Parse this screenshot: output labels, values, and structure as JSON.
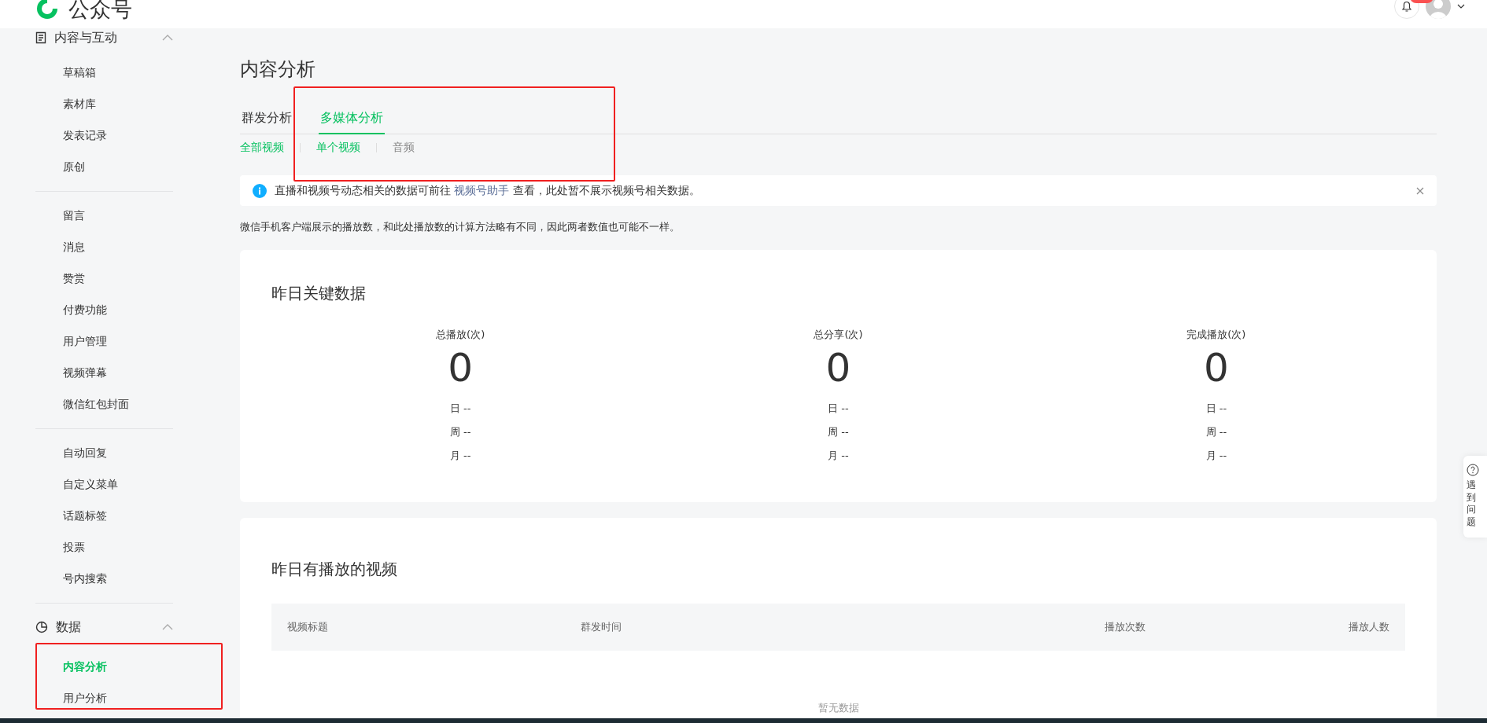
{
  "header": {
    "logo_text": "公众号"
  },
  "sidebar": {
    "groups": [
      {
        "title": "内容与互动",
        "expanded": true,
        "sections": [
          [
            {
              "label": "草稿箱",
              "selected": false
            },
            {
              "label": "素材库",
              "selected": false
            },
            {
              "label": "发表记录",
              "selected": false
            },
            {
              "label": "原创",
              "selected": false
            }
          ],
          [
            {
              "label": "留言",
              "selected": false
            },
            {
              "label": "消息",
              "selected": false
            },
            {
              "label": "赞赏",
              "selected": false
            },
            {
              "label": "付费功能",
              "selected": false
            },
            {
              "label": "用户管理",
              "selected": false
            },
            {
              "label": "视频弹幕",
              "selected": false
            },
            {
              "label": "微信红包封面",
              "selected": false
            }
          ],
          [
            {
              "label": "自动回复",
              "selected": false
            },
            {
              "label": "自定义菜单",
              "selected": false
            },
            {
              "label": "话题标签",
              "selected": false
            },
            {
              "label": "投票",
              "selected": false
            },
            {
              "label": "号内搜索",
              "selected": false
            }
          ]
        ]
      },
      {
        "title": "数据",
        "expanded": true,
        "sections": [
          [
            {
              "label": "内容分析",
              "selected": true
            },
            {
              "label": "用户分析",
              "selected": false
            }
          ]
        ]
      }
    ]
  },
  "page_title": "内容分析",
  "tabs": [
    {
      "label": "群发分析",
      "selected": false
    },
    {
      "label": "多媒体分析",
      "selected": true
    }
  ],
  "subtabs": [
    {
      "label": "全部视频",
      "selected": true
    },
    {
      "label": "单个视频",
      "selected": true
    },
    {
      "label": "音频",
      "selected": false
    }
  ],
  "notice": {
    "before": "直播和视频号动态相关的数据可前往 ",
    "link": "视频号助手",
    "after": " 查看，此处暂不展示视频号相关数据。"
  },
  "note": "微信手机客户端展示的播放数，和此处播放数的计算方法略有不同，因此两者数值也可能不一样。",
  "key_data": {
    "title": "昨日关键数据",
    "metrics": [
      {
        "label": "总播放(次)",
        "value": "0",
        "rows": [
          "日 --",
          "周 --",
          "月 --"
        ]
      },
      {
        "label": "总分享(次)",
        "value": "0",
        "rows": [
          "日 --",
          "周 --",
          "月 --"
        ]
      },
      {
        "label": "完成播放(次)",
        "value": "0",
        "rows": [
          "日 --",
          "周 --",
          "月 --"
        ]
      }
    ]
  },
  "videos": {
    "title": "昨日有播放的视频",
    "columns": [
      "视频标题",
      "群发时间",
      "播放次数",
      "播放人数"
    ],
    "empty_text": "暂无数据"
  },
  "help_widget": {
    "text": "遇到问题"
  }
}
